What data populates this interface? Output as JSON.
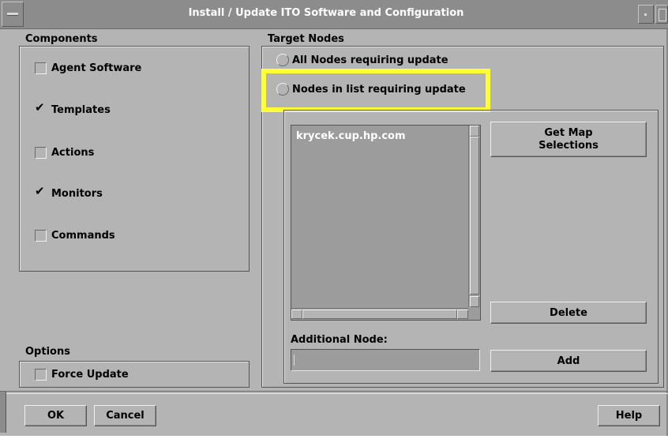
{
  "window": {
    "title": "Install / Update ITO Software and Configuration"
  },
  "components": {
    "label": "Components",
    "items": [
      {
        "label": "Agent Software",
        "checked": false
      },
      {
        "label": "Templates",
        "checked": true
      },
      {
        "label": "Actions",
        "checked": false
      },
      {
        "label": "Monitors",
        "checked": true
      },
      {
        "label": "Commands",
        "checked": false
      }
    ]
  },
  "options": {
    "label": "Options",
    "force_update": {
      "label": "Force Update",
      "checked": false
    }
  },
  "target_nodes": {
    "label": "Target Nodes",
    "radio_all": "All Nodes requiring update",
    "radio_list": "Nodes in list requiring update",
    "selected": "none",
    "highlight_color": "#ffff33",
    "list_items": [
      "krycek.cup.hp.com"
    ],
    "get_map_line1": "Get Map",
    "get_map_line2": "Selections",
    "delete_label": "Delete",
    "additional_node_label": "Additional Node:",
    "additional_node_value": "",
    "add_label": "Add"
  },
  "footer": {
    "ok_label": "OK",
    "cancel_label": "Cancel",
    "help_label": "Help"
  },
  "colors": {
    "dialog_bg": "#b4b4b4",
    "titlebar_bg": "#8c8c8c",
    "list_bg": "#9c9c9c"
  }
}
